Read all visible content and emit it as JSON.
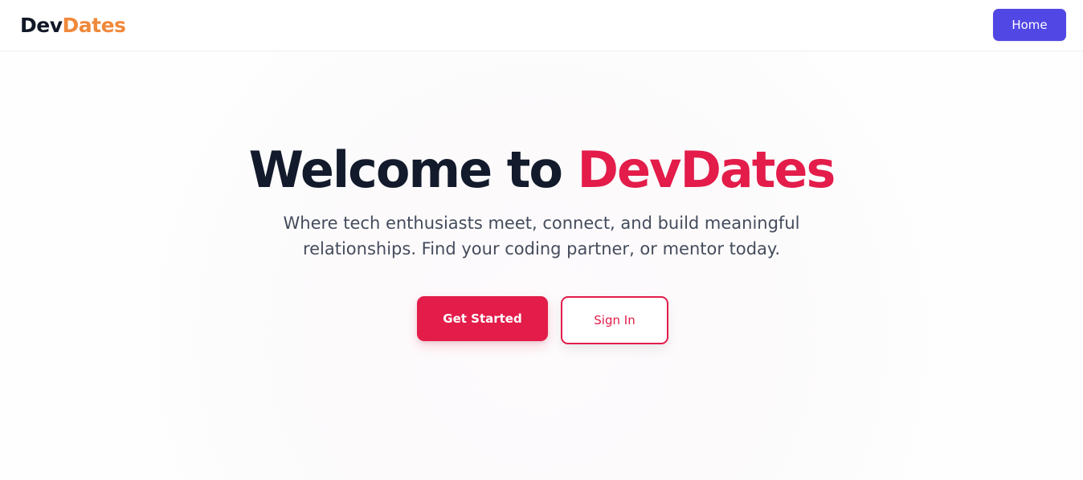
{
  "navbar": {
    "logo_part1": "Dev",
    "logo_part2": "Dates",
    "home_label": "Home"
  },
  "hero": {
    "title_part1": "Welcome to",
    "title_part2": "DevDates",
    "subtitle": "Where tech enthusiasts meet, connect, and build meaningful relationships. Find your coding partner, or mentor today.",
    "primary_button": "Get Started",
    "secondary_button": "Sign In"
  },
  "colors": {
    "brand_dark": "#111827",
    "brand_orange": "#f0883a",
    "accent_red": "#e31c4a",
    "home_button": "#5147e5"
  }
}
